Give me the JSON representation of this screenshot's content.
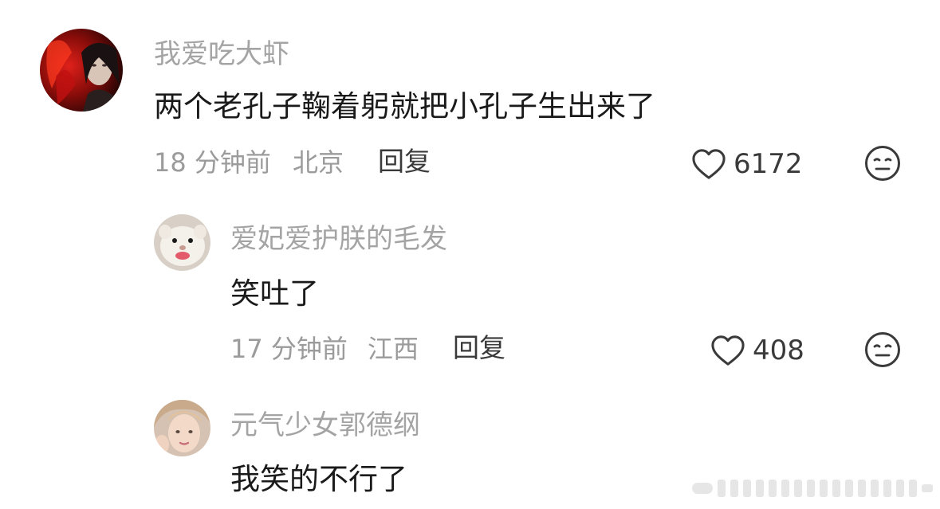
{
  "comments": [
    {
      "username": "我爱吃大虾",
      "content": "两个老孔子鞠着躬就把小孔子生出来了",
      "time": "18 分钟前",
      "location": "北京",
      "reply_label": "回复",
      "likes": "6172",
      "avatar_icon": "red-character-avatar"
    },
    {
      "username": "爱妃爱护朕的毛发",
      "content": "笑吐了",
      "time": "17 分钟前",
      "location": "江西",
      "reply_label": "回复",
      "likes": "408",
      "avatar_icon": "ferret-avatar"
    },
    {
      "username": "元气少女郭德纲",
      "content": "我笑的不行了",
      "avatar_icon": "girl-avatar"
    }
  ],
  "icons": {
    "like": "heart-outline-icon",
    "dislike": "meh-face-icon"
  },
  "colors": {
    "username": "#a4a4a4",
    "content": "#1a1a1a",
    "meta": "#9b9b9b",
    "action": "#3a3a3a"
  }
}
